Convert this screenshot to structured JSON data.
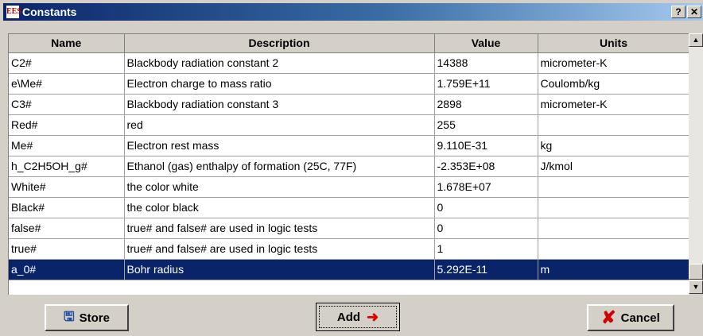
{
  "window": {
    "title": "Constants",
    "app_icon": "EES",
    "help_label": "?",
    "close_label": "✕"
  },
  "table": {
    "columns": [
      "Name",
      "Description",
      "Value",
      "Units"
    ],
    "rows": [
      {
        "name": "C2#",
        "description": "Blackbody radiation constant 2",
        "value": "14388",
        "units": "micrometer-K"
      },
      {
        "name": "e\\Me#",
        "description": "Electron charge to mass ratio",
        "value": "1.759E+11",
        "units": "Coulomb/kg"
      },
      {
        "name": "C3#",
        "description": "Blackbody radiation constant 3",
        "value": "2898",
        "units": "micrometer-K"
      },
      {
        "name": "Red#",
        "description": "red",
        "value": "255",
        "units": ""
      },
      {
        "name": "Me#",
        "description": "Electron rest mass",
        "value": "9.110E-31",
        "units": "kg"
      },
      {
        "name": "h_C2H5OH_g#",
        "description": "Ethanol (gas) enthalpy of formation (25C, 77F)",
        "value": "-2.353E+08",
        "units": "J/kmol"
      },
      {
        "name": "White#",
        "description": "the color white",
        "value": "1.678E+07",
        "units": ""
      },
      {
        "name": "Black#",
        "description": "the color black",
        "value": "0",
        "units": ""
      },
      {
        "name": "false#",
        "description": "true# and false# are used in logic tests",
        "value": "0",
        "units": ""
      },
      {
        "name": "true#",
        "description": "true# and false# are used in logic tests",
        "value": "1",
        "units": ""
      },
      {
        "name": "a_0#",
        "description": "Bohr radius",
        "value": "5.292E-11",
        "units": "m",
        "selected": true
      }
    ]
  },
  "buttons": {
    "store": "Store",
    "add": "Add",
    "cancel": "Cancel"
  },
  "icons": {
    "store": "floppy-disk-icon",
    "add": "right-arrow-icon",
    "cancel": "red-x-icon"
  },
  "colors": {
    "selection": "#0a246a",
    "titlebar": "#0a246a"
  }
}
